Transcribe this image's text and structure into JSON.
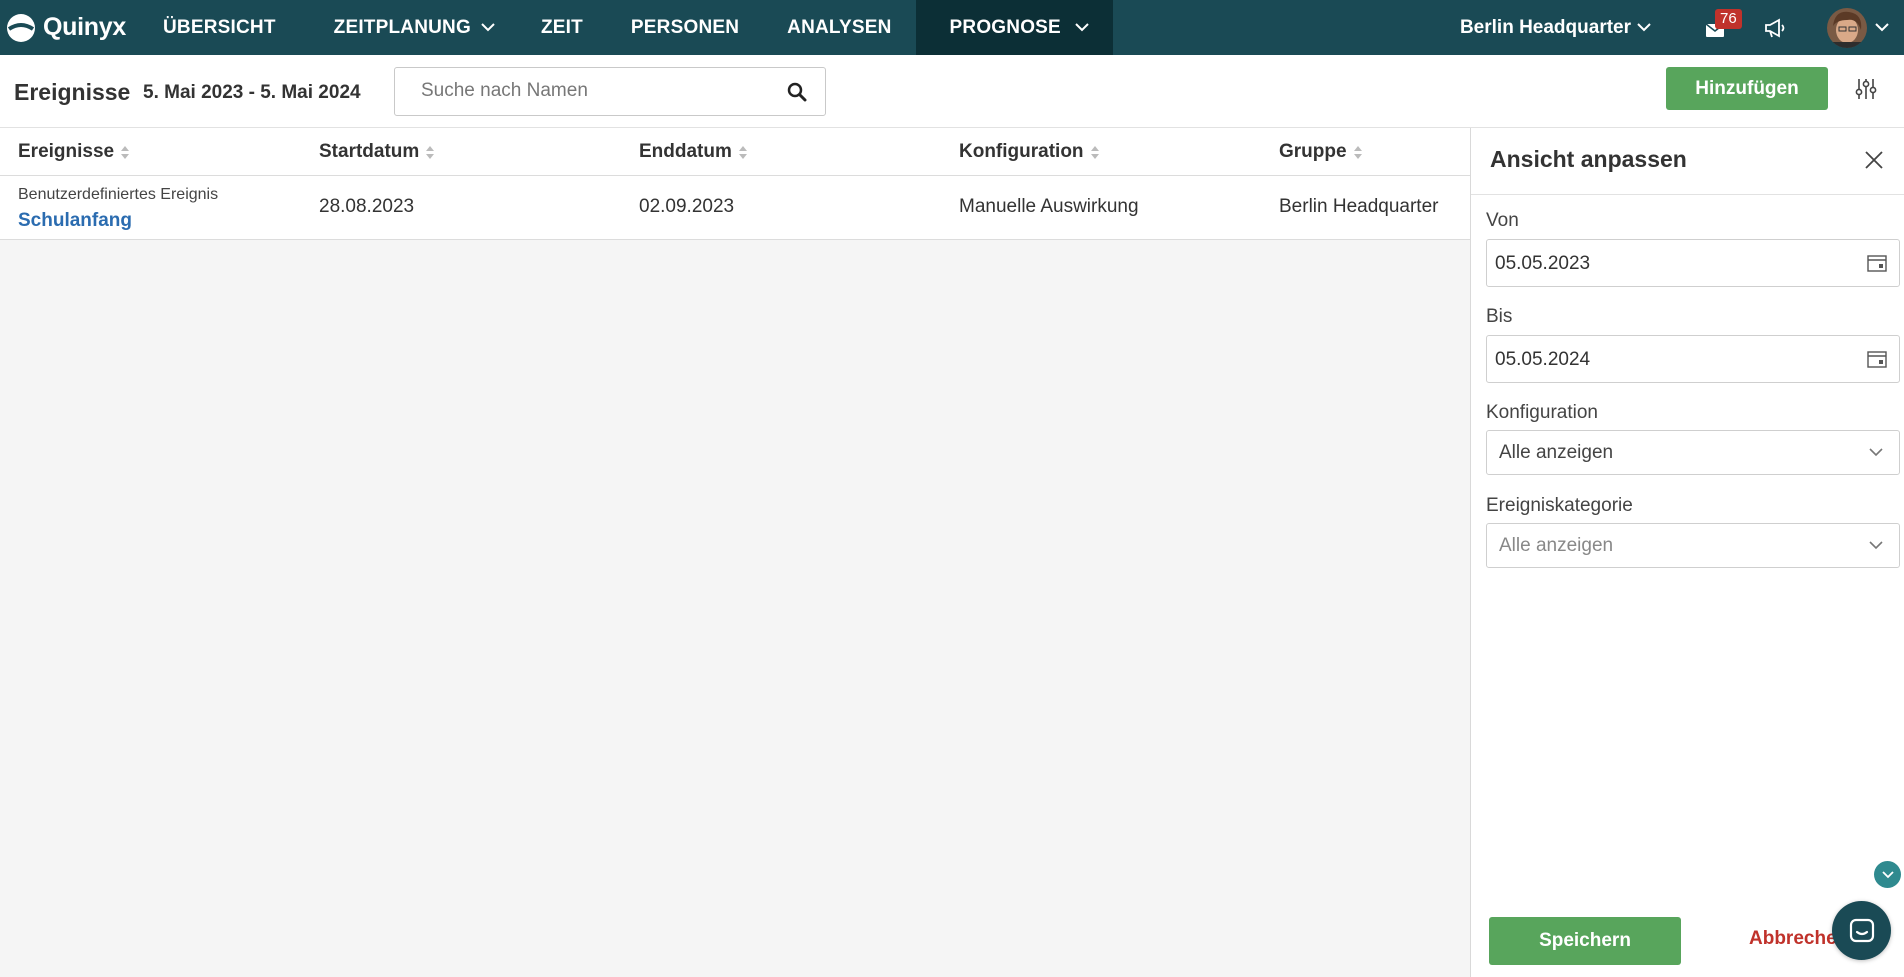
{
  "app": {
    "brand": "Quinyx",
    "nav": [
      {
        "label": "ÜBERSICHT"
      },
      {
        "label": "ZEITPLANUNG"
      },
      {
        "label": "ZEIT"
      },
      {
        "label": "PERSONEN"
      },
      {
        "label": "ANALYSEN"
      },
      {
        "label": "PROGNOSE"
      }
    ],
    "active_nav": "PROGNOSE",
    "location": "Berlin Headquarter",
    "notifications_count": "76",
    "icons": [
      "logo-icon",
      "chevron-down-icon",
      "mail-icon",
      "megaphone-icon",
      "avatar"
    ]
  },
  "subheader": {
    "title": "Ereignisse",
    "date_range": "5. Mai 2023 - 5. Mai 2024",
    "search_placeholder": "Suche nach Namen",
    "add_label": "Hinzufügen"
  },
  "table": {
    "columns": [
      "Ereignisse",
      "Startdatum",
      "Enddatum",
      "Konfiguration",
      "Gruppe"
    ],
    "rows": [
      {
        "category": "Benutzerdefiniertes Ereignis",
        "name": "Schulanfang",
        "start": "28.08.2023",
        "end": "02.09.2023",
        "config": "Manuelle Auswirkung",
        "group": "Berlin Headquarter"
      }
    ]
  },
  "panel": {
    "title": "Ansicht anpassen",
    "from_label": "Von",
    "from_value": "05.05.2023",
    "to_label": "Bis",
    "to_value": "05.05.2024",
    "config_label": "Konfiguration",
    "config_value": "Alle anzeigen",
    "category_label": "Ereigniskategorie",
    "category_value": "Alle anzeigen",
    "save_label": "Speichern",
    "cancel_label": "Abbrechen"
  },
  "colors": {
    "nav_bg": "#1a4a55",
    "nav_active": "#0c2f36",
    "primary_green": "#58a55c",
    "link_blue": "#2b6cb0",
    "danger_red": "#c0322b"
  }
}
